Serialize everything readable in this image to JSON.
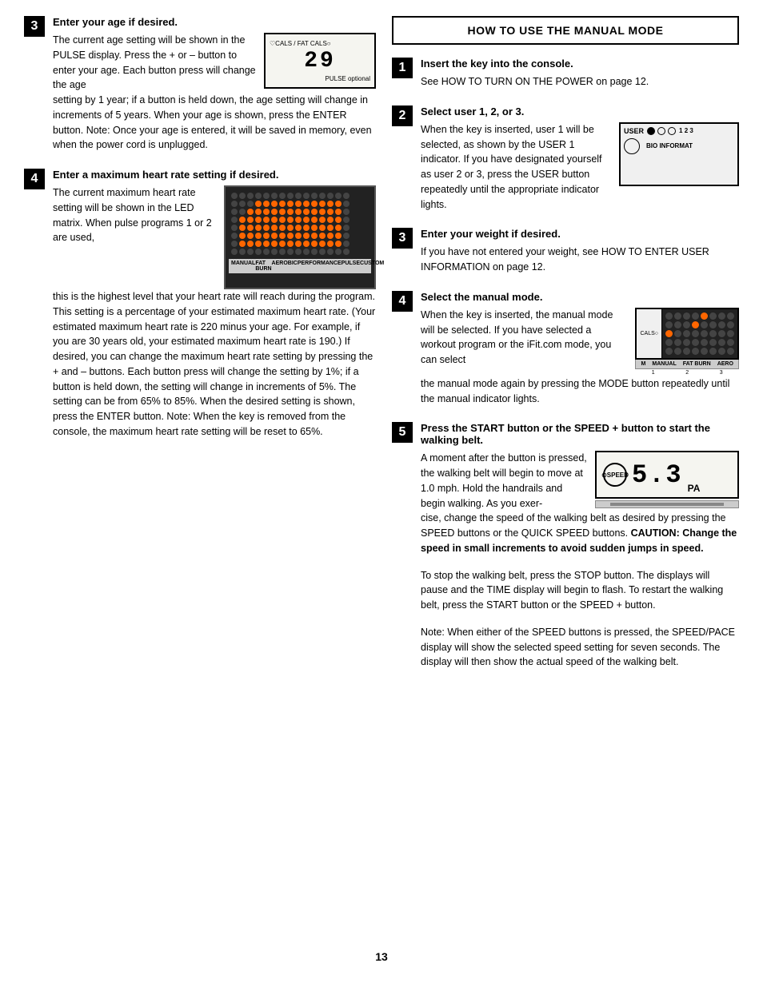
{
  "left": {
    "step3": {
      "num": "3",
      "title": "Enter your age if desired.",
      "text": "The current age setting will be shown in the PULSE display. Press the + or – button to enter your age. Each button press will change the age setting by 1 year; if a button is held down, the age setting will change in increments of 5 years. When your age is shown, press the ENTER button. Note: Once your age is entered, it will be saved in memory, even when the power cord is unplugged."
    },
    "step4": {
      "num": "4",
      "title": "Enter a maximum heart rate setting if desired.",
      "text1": "The current maximum heart rate setting will be shown in the LED matrix. When pulse programs 1 or 2 are used,",
      "text2": "this is the highest level that your heart rate will reach during the program. This setting is a percentage of your estimated maximum heart rate. (Your estimated maximum heart rate is 220 minus your age. For example, if you are 30 years old, your estimated maximum heart rate is 190.) If desired, you can change the maximum heart rate setting by pressing the + and – buttons. Each button press will change the setting by 1%; if a button is held down, the setting will change in increments of 5%. The setting can be from 65% to 85%. When the desired setting is shown, press the ENTER button. Note: When the key is removed from the console, the maximum heart rate setting will be reset to 65%."
    }
  },
  "right": {
    "header": "HOW TO USE THE MANUAL MODE",
    "step1": {
      "num": "1",
      "title": "Insert the key into the console.",
      "text": "See HOW TO TURN ON THE POWER on page 12."
    },
    "step2": {
      "num": "2",
      "title": "Select user 1, 2, or 3.",
      "text": "When the key is inserted, user 1 will be selected, as shown by the USER 1 indicator. If you have designated yourself as user 2 or 3, press the USER button repeatedly until the appropriate indicator lights."
    },
    "step3": {
      "num": "3",
      "title": "Enter your weight if desired.",
      "text": "If you have not entered your weight, see HOW TO ENTER USER INFORMATION on page 12."
    },
    "step4": {
      "num": "4",
      "title": "Select the manual mode.",
      "text1": "When the key is inserted, the manual mode will be selected. If you have selected a workout program or the iFit.com mode, you can select",
      "text2": "the manual mode again by pressing the MODE button repeatedly until the manual indicator lights."
    },
    "step5": {
      "num": "5",
      "title": "Press the START button or the SPEED + button to start the walking belt.",
      "text1": "A moment after the button is pressed, the walking belt will begin to move at 1.0 mph. Hold the handrails and begin walking. As you exer-",
      "text2": "cise, change the speed of the walking belt as desired by pressing the SPEED buttons or the QUICK SPEED buttons. ",
      "caution": "CAUTION: Change the speed in small increments to avoid sudden jumps in speed.",
      "text3": "To stop the walking belt, press the STOP button. The displays will pause and the TIME display will begin to flash. To restart the walking belt, press the START button or the SPEED + button.",
      "text4": "Note: When either of the SPEED buttons is pressed, the SPEED/PACE display will show the selected speed setting for seven seconds. The display will then show the actual speed of the walking belt."
    }
  },
  "page_number": "13"
}
